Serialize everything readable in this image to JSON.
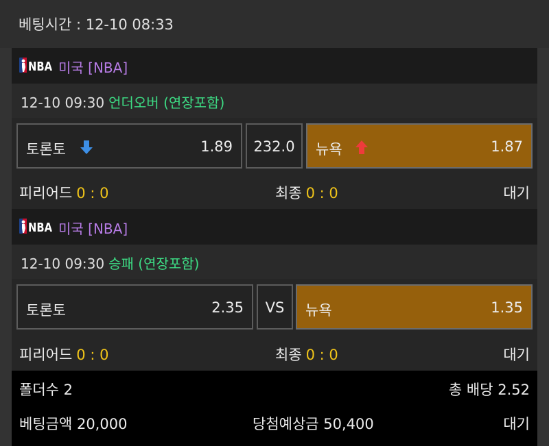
{
  "bet_time": "베팅시간 : 12-10 08:33",
  "games": [
    {
      "league": "미국 [NBA]",
      "datetime": "12-10 09:30",
      "market": "언더오버 (연장포함)",
      "home_team": "토론토",
      "home_odds": "1.89",
      "home_arrow": "down",
      "center": "232.0",
      "away_team": "뉴욕",
      "away_odds": "1.87",
      "away_arrow": "up",
      "selected": "away",
      "period_label": "피리어드",
      "period_score": "0 : 0",
      "final_label": "최종",
      "final_score": "0 : 0",
      "status": "대기"
    },
    {
      "league": "미국 [NBA]",
      "datetime": "12-10 09:30",
      "market": "승패 (연장포함)",
      "home_team": "토론토",
      "home_odds": "2.35",
      "center": "VS",
      "away_team": "뉴욕",
      "away_odds": "1.35",
      "selected": "away",
      "period_label": "피리어드",
      "period_score": "0 : 0",
      "final_label": "최종",
      "final_score": "0 : 0",
      "status": "대기"
    }
  ],
  "summary": {
    "folder_count": "폴더수 2",
    "total_odds": "총 배당 2.52",
    "bet_amount": "베팅금액 20,000",
    "expected_win": "당첨예상금 50,400",
    "status": "대기"
  },
  "colors": {
    "league_text": "#b77ce6",
    "market_text": "#3ddc84",
    "score_text": "#f0c419",
    "selected_bg": "#96600c",
    "arrow_down": "#3d8fe6",
    "arrow_up": "#ef3b3b"
  },
  "icons": {
    "league_logo": "nba-logo-icon",
    "down": "arrow-down-icon",
    "up": "arrow-up-icon"
  }
}
